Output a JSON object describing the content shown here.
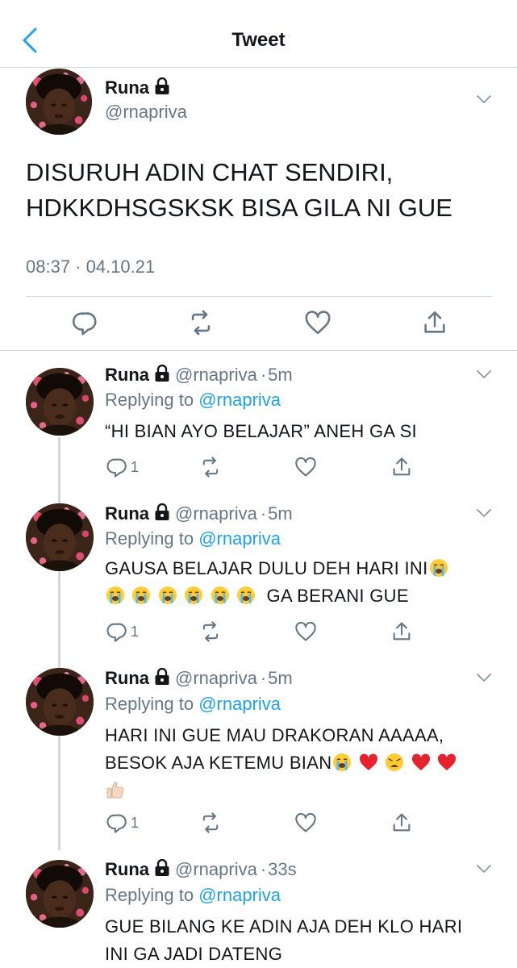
{
  "header": {
    "title": "Tweet"
  },
  "main_tweet": {
    "name": "Runa",
    "handle": "@rnapriva",
    "text_line1": "DISURUH ADIN CHAT SENDIRI,",
    "text_line2": "HDKKDHSGSKSK BISA GILA NI GUE",
    "timestamp": "08:37 · 04.10.21"
  },
  "replies": [
    {
      "name": "Runa",
      "handle": "@rnapriva",
      "time": "5m",
      "replying_prefix": "Replying to",
      "replying_to": "@rnapriva",
      "text": "“HI BIAN AYO BELAJAR” ANEH GA SI",
      "reply_count": "1"
    },
    {
      "name": "Runa",
      "handle": "@rnapriva",
      "time": "5m",
      "replying_prefix": "Replying to",
      "replying_to": "@rnapriva",
      "text_line1": "GAUSA BELAJAR DULU DEH HARI INI",
      "text_line2_tail": "GA BERANI GUE",
      "reply_count": "1"
    },
    {
      "name": "Runa",
      "handle": "@rnapriva",
      "time": "5m",
      "replying_prefix": "Replying to",
      "replying_to": "@rnapriva",
      "text_line1": "HARI INI GUE MAU DRAKORAN AAAAA,",
      "text_line2": "BESOK AJA KETEMU BIAN",
      "reply_count": "1"
    },
    {
      "name": "Runa",
      "handle": "@rnapriva",
      "time": "33s",
      "replying_prefix": "Replying to",
      "replying_to": "@rnapriva",
      "text_line1": "GUE BILANG KE ADIN AJA DEH KLO HARI",
      "text_line2": "INI GA JADI DATENG"
    }
  ],
  "icons": {
    "back": "chevron-left-icon",
    "lock": "lock-icon",
    "caret": "chevron-down-icon",
    "reply": "reply-icon",
    "retweet": "retweet-icon",
    "like": "heart-icon",
    "share": "share-icon",
    "emoji_cry": "loudly-crying-face",
    "emoji_heart": "red-heart",
    "emoji_weary": "weary-face",
    "emoji_thumbs": "thumbs-up"
  },
  "colors": {
    "accent": "#1da1f2",
    "muted": "#657786",
    "text": "#14171a",
    "divider": "#cfd9de"
  }
}
